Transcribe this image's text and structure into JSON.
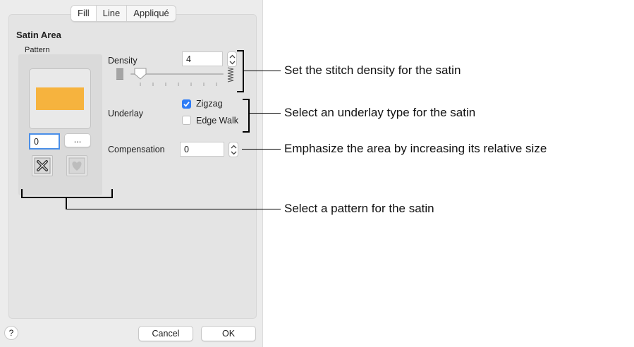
{
  "tabs": [
    "Fill",
    "Line",
    "Appliqué"
  ],
  "section_title": "Satin Area",
  "pattern": {
    "label": "Pattern",
    "swatch_color": "#f6b33e",
    "number_value": "0",
    "browse_label": "...",
    "icons": [
      "clear-pattern-icon",
      "favorite-heart-icon"
    ]
  },
  "density": {
    "label": "Density",
    "value": "4",
    "slider_level": 0.1
  },
  "underlay": {
    "label": "Underlay",
    "options": [
      {
        "label": "Zigzag",
        "checked": true
      },
      {
        "label": "Edge Walk",
        "checked": false
      }
    ]
  },
  "compensation": {
    "label": "Compensation",
    "value": "0"
  },
  "buttons": {
    "help": "?",
    "cancel": "Cancel",
    "ok": "OK"
  },
  "callouts": {
    "density": "Set the stitch density for the satin",
    "underlay": "Select an underlay type for the satin",
    "compensation": "Emphasize the area by increasing its relative size",
    "pattern": "Select a pattern for the satin"
  }
}
